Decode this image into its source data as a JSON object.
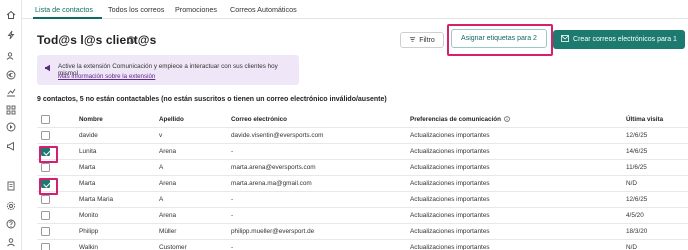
{
  "tabs": [
    {
      "label": "Lista de contactos",
      "active": true
    },
    {
      "label": "Todos los correos",
      "active": false
    },
    {
      "label": "Promociones",
      "active": false
    },
    {
      "label": "Correos Automáticos",
      "active": false
    }
  ],
  "rail_icons": [
    "home-icon",
    "bolt-icon",
    "users-icon",
    "euro-icon",
    "chart-icon",
    "grid-icon",
    "target-icon",
    "megaphone-icon",
    "document-icon",
    "settings-icon",
    "help-icon"
  ],
  "page": {
    "title": "Tod@s l@s client@s"
  },
  "toolbar": {
    "filter_label": "Filtro",
    "assign_tags_label": "Asignar etiquetas para 2",
    "create_email_label": "Crear correos electrónicos para 1"
  },
  "banner": {
    "text": "Active la extensión Comunicación y empiece a interactuar con sus clientes hoy mismo!",
    "link": "Más información sobre la extensión"
  },
  "summary": "9 contactos, 5 no están contactables (no están suscritos o tienen un correo electrónico inválido/ausente)",
  "table": {
    "headers": {
      "name": "Nombre",
      "last": "Apellido",
      "email": "Correo electrónico",
      "pref": "Preferencias de comunicación",
      "visit": "Última visita"
    },
    "rows": [
      {
        "checked": false,
        "name": "davide",
        "last": "v",
        "email": "davide.visentin@eversports.com",
        "pref": "Actualizaciones importantes",
        "visit": "12/6/25"
      },
      {
        "checked": true,
        "name": "Lunita",
        "last": "Arena",
        "email": "-",
        "pref": "Actualizaciones importantes",
        "visit": "14/6/25"
      },
      {
        "checked": false,
        "name": "Marta",
        "last": "A",
        "email": "marta.arena@eversports.com",
        "pref": "Actualizaciones importantes",
        "visit": "11/6/25"
      },
      {
        "checked": true,
        "name": "Marta",
        "last": "Arena",
        "email": "marta.arena.ma@gmail.com",
        "pref": "Actualizaciones importantes",
        "visit": "N/D"
      },
      {
        "checked": false,
        "name": "Marta Maria",
        "last": "A",
        "email": "-",
        "pref": "Actualizaciones importantes",
        "visit": "12/6/25"
      },
      {
        "checked": false,
        "name": "Monito",
        "last": "Arena",
        "email": "-",
        "pref": "Actualizaciones importantes",
        "visit": "4/5/20"
      },
      {
        "checked": false,
        "name": "Philipp",
        "last": "Müller",
        "email": "philipp.mueller@eversport.de",
        "pref": "Actualizaciones importantes",
        "visit": "18/3/20"
      },
      {
        "checked": false,
        "name": "Walkin",
        "last": "Customer",
        "email": "-",
        "pref": "Actualizaciones importantes",
        "visit": "N/D"
      }
    ]
  },
  "colors": {
    "accent": "#1d7a6e",
    "highlight": "#d61f6e",
    "banner_bg": "#efe7f7"
  }
}
